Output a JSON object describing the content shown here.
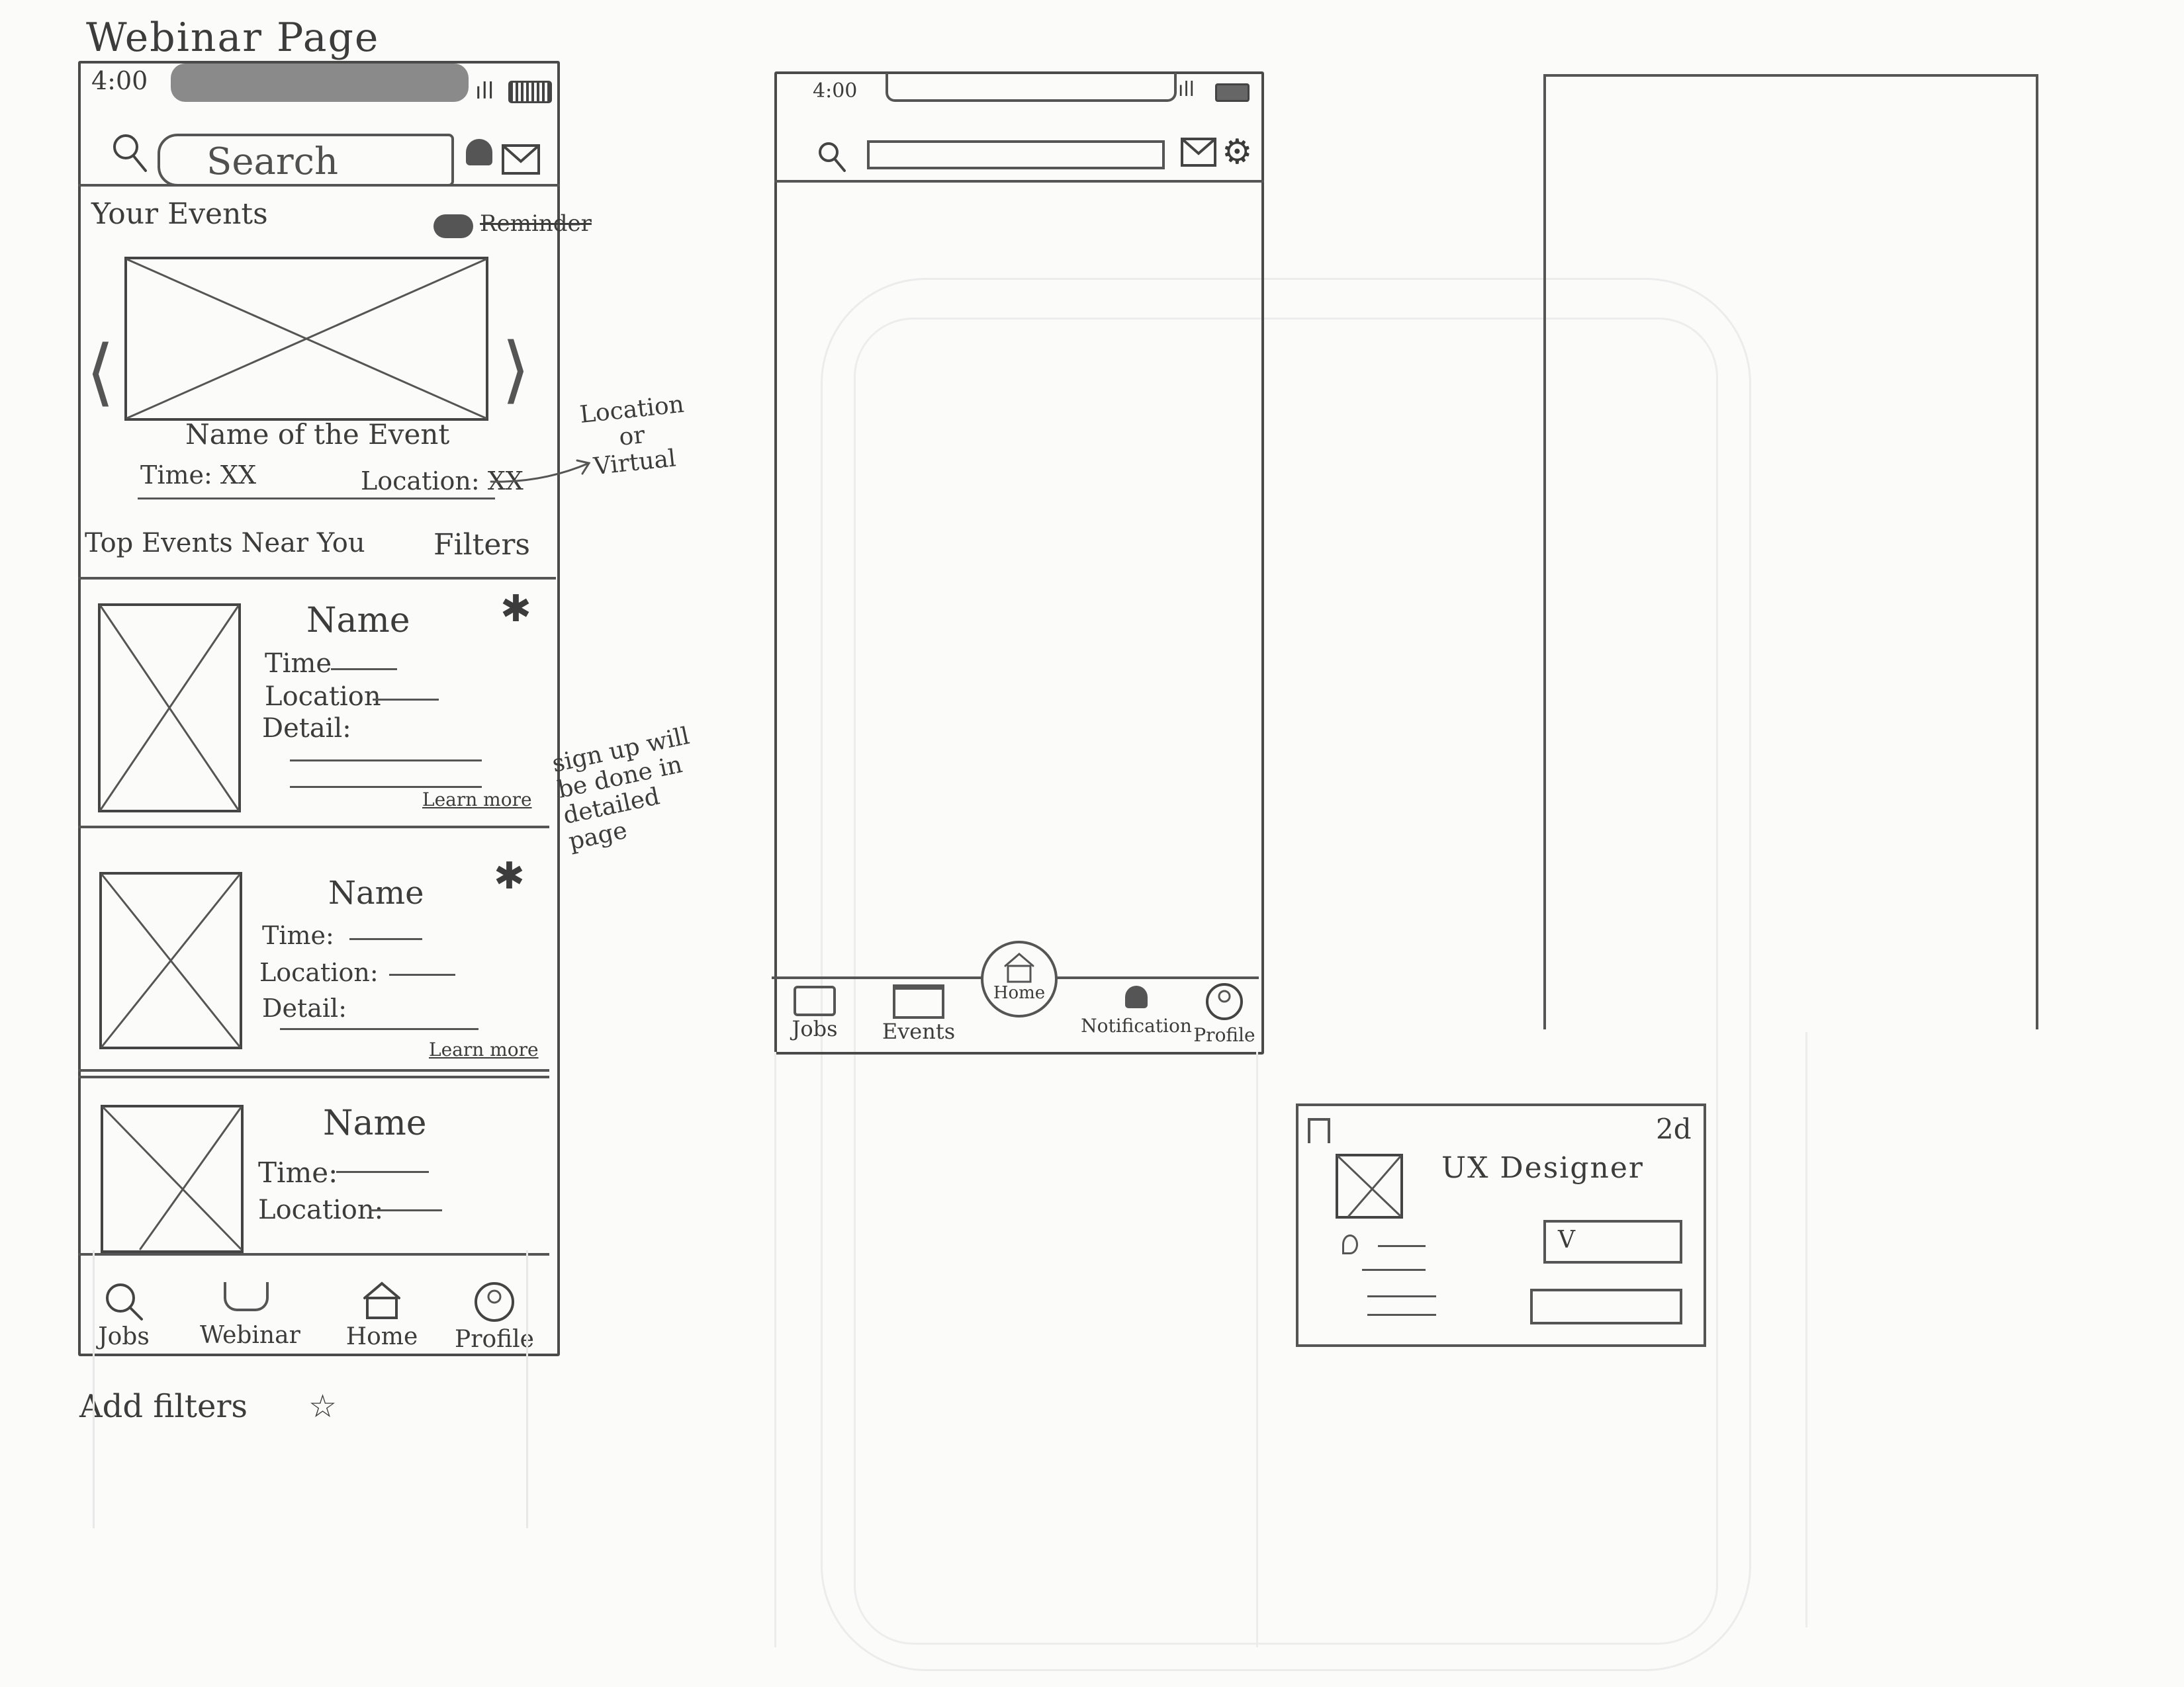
{
  "page": {
    "title": "Webinar Page"
  },
  "phone1": {
    "status_time": "4:00",
    "search_placeholder": "Search",
    "your_events": {
      "heading": "Your Events",
      "reminder_label": "Reminder",
      "event_name": "Name of the Event",
      "time": "Time: XX",
      "location": "Location: XX"
    },
    "top_events": {
      "heading": "Top Events Near You",
      "filters_label": "Filters"
    },
    "cards": [
      {
        "name": "Name",
        "time": "Time",
        "location": "Location",
        "detail": "Detail:",
        "learn_more": "Learn more"
      },
      {
        "name": "Name",
        "time": "Time:",
        "location": "Location:",
        "detail": "Detail:",
        "learn_more": "Learn more"
      },
      {
        "name": "Name",
        "time": "Time:",
        "location": "Location:"
      }
    ],
    "bottom_nav": [
      "Jobs",
      "Webinar",
      "Home",
      "Profile"
    ]
  },
  "annotations": {
    "location_note": "Location or Virtual",
    "signup_note": "sign up will be done in detailed page",
    "add_filters": "Add filters"
  },
  "phone2": {
    "status_time": "4:00",
    "bottom_nav": [
      "Jobs",
      "Events",
      "Home",
      "Notification",
      "Profile"
    ]
  },
  "job_card": {
    "age": "2d",
    "title": "UX Designer",
    "button_label": "V"
  }
}
